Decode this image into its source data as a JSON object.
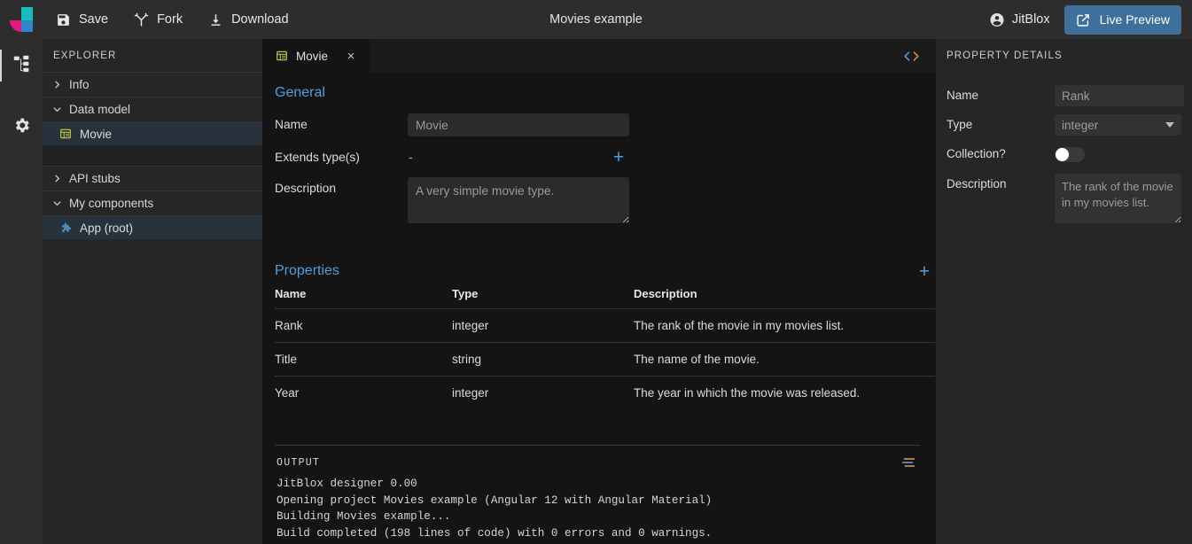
{
  "toolbar": {
    "logo_name": "jitblox-logo",
    "buttons": [
      {
        "label": "Save",
        "icon": "save-icon"
      },
      {
        "label": "Fork",
        "icon": "fork-icon"
      },
      {
        "label": "Download",
        "icon": "download-icon"
      }
    ],
    "document_title": "Movies example",
    "user": "JitBlox",
    "user_icon": "account-circle-icon",
    "live_preview_label": "Live Preview",
    "live_preview_icon": "external-link-icon",
    "accent_color": "#3f6f9b"
  },
  "activity_bar": {
    "items": [
      {
        "name": "structure-icon",
        "active": true
      },
      {
        "name": "settings-gear-icon",
        "active": false
      }
    ]
  },
  "explorer": {
    "title": "EXPLORER",
    "groups": [
      {
        "label": "Info",
        "expanded": false,
        "children": []
      },
      {
        "label": "Data model",
        "expanded": true,
        "children": [
          {
            "label": "Movie",
            "icon": "data-type-icon",
            "selected": true
          }
        ]
      },
      {
        "label": "API stubs",
        "expanded": false,
        "children": []
      },
      {
        "label": "My components",
        "expanded": true,
        "children": [
          {
            "label": "App (root)",
            "icon": "puzzle-piece-icon",
            "selected": false
          }
        ]
      }
    ]
  },
  "editor": {
    "tab": {
      "label": "Movie",
      "icon": "data-type-icon",
      "close_label": "×"
    },
    "code_toggle_icon": "code-brackets-icon",
    "general": {
      "heading": "General",
      "name_label": "Name",
      "name_value": "Movie",
      "extends_label": "Extends type(s)",
      "extends_value": "-",
      "extends_add_label": "+",
      "description_label": "Description",
      "description_value": "A very simple movie type."
    },
    "properties": {
      "heading": "Properties",
      "add_label": "+",
      "columns": [
        "Name",
        "Type",
        "Description"
      ],
      "rows": [
        {
          "name": "Rank",
          "type": "integer",
          "description": "The rank of the movie in my movies list."
        },
        {
          "name": "Title",
          "type": "string",
          "description": "The name of the movie."
        },
        {
          "name": "Year",
          "type": "integer",
          "description": "The year in which the movie was released."
        }
      ]
    }
  },
  "output": {
    "title": "OUTPUT",
    "action_icon": "clear-output-icon",
    "lines": [
      "JitBlox designer 0.00",
      "Opening project Movies example (Angular 12 with Angular Material)",
      "Building Movies example...",
      "Build completed (198 lines of code) with 0 errors and 0 warnings."
    ]
  },
  "property_details": {
    "title": "PROPERTY DETAILS",
    "name_label": "Name",
    "name_value": "Rank",
    "type_label": "Type",
    "type_value": "integer",
    "collection_label": "Collection?",
    "collection_on": false,
    "description_label": "Description",
    "description_value": "The rank of the movie in my movies list."
  }
}
